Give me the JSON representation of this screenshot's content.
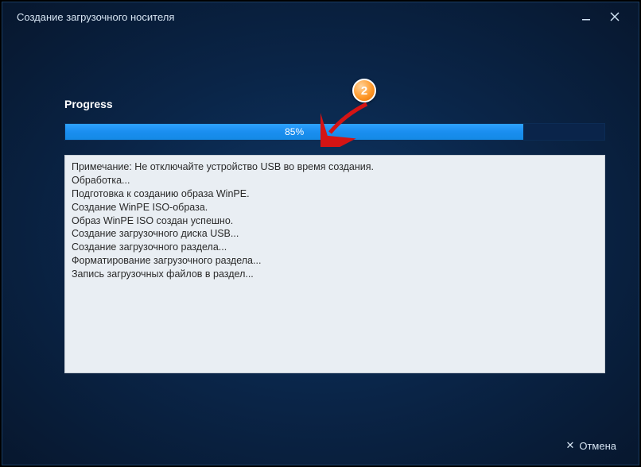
{
  "window": {
    "title": "Создание загрузочного носителя"
  },
  "progress": {
    "label": "Progress",
    "percent": 85,
    "percent_text": "85%"
  },
  "log": {
    "lines": [
      "Примечание: Не отключайте устройство USB во время создания.",
      "Обработка...",
      "Подготовка к созданию образа WinPE.",
      "Создание WinPE ISO-образа.",
      "Образ WinPE ISO создан успешно.",
      "Создание загрузочного диска USB...",
      "Создание загрузочного раздела...",
      "Форматирование загрузочного раздела...",
      "Запись загрузочных файлов в раздел..."
    ]
  },
  "footer": {
    "cancel_label": "Отмена"
  },
  "annotation": {
    "step_number": "2"
  },
  "icons": {
    "minimize": "minimize-icon",
    "close": "close-icon"
  }
}
